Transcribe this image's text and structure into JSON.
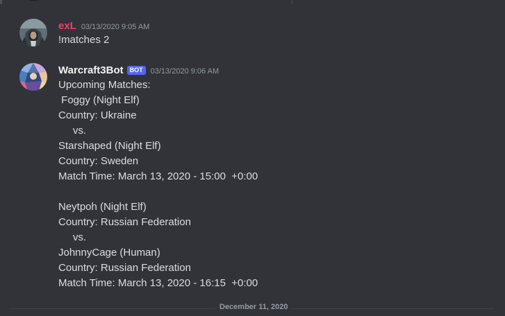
{
  "messages": [
    {
      "author": "exL",
      "author_color": "#ed4264",
      "timestamp": "03/13/2020 9:05 AM",
      "lines": [
        "!matches 2"
      ]
    },
    {
      "author": "Warcraft3Bot",
      "author_color": "#f2f3f5",
      "bot_tag": "BOT",
      "timestamp": "03/13/2020 9:06 AM",
      "lines": [
        "Upcoming Matches:",
        " Foggy (Night Elf)",
        "Country: Ukraine",
        "     vs.",
        "Starshaped (Night Elf)",
        "Country: Sweden",
        "Match Time: March 13, 2020 - 15:00  +0:00",
        "",
        "Neytpoh (Night Elf)",
        "Country: Russian Federation",
        "     vs.",
        "JohnnyCage (Human)",
        "Country: Russian Federation",
        "Match Time: March 13, 2020 - 16:15  +0:00"
      ]
    }
  ],
  "date_divider": "December 11, 2020",
  "colors": {
    "background": "#313338",
    "text": "#dbdee1",
    "muted": "#949ba4",
    "bot_badge": "#5865f2"
  },
  "icons": {
    "user_avatar": "hooded-warrior-avatar",
    "bot_avatar": "stained-glass-avatar"
  }
}
